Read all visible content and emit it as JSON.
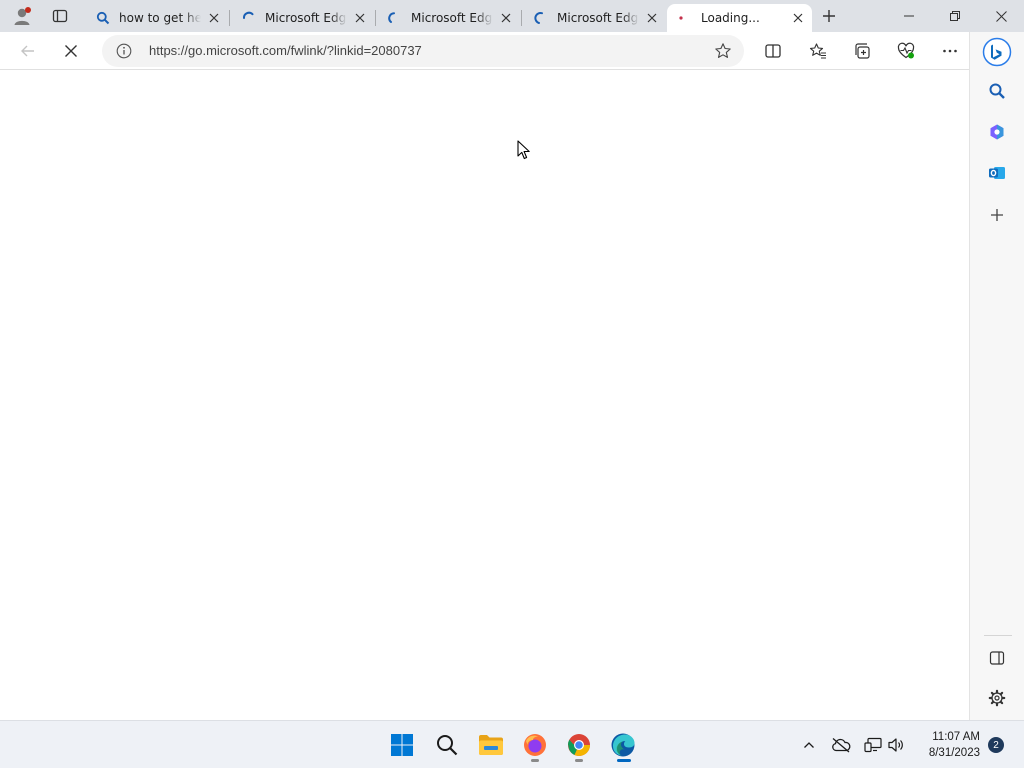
{
  "tabs": [
    {
      "title": "how to get help in windows",
      "icon": "search-icon"
    },
    {
      "title": "Microsoft Edge",
      "icon": "loading-spinner-icon"
    },
    {
      "title": "Microsoft Edge",
      "icon": "loading-spinner-icon"
    },
    {
      "title": "Microsoft Edge",
      "icon": "loading-spinner-icon"
    },
    {
      "title": "Loading...",
      "icon": "loading-dot-icon",
      "active": true
    }
  ],
  "address_bar": {
    "url": "https://go.microsoft.com/fwlink/?linkid=2080737"
  },
  "taskbar": {
    "apps": [
      "windows-start",
      "search",
      "file-explorer",
      "firefox",
      "chrome",
      "edge"
    ],
    "time": "11:07 AM",
    "date": "8/31/2023",
    "notification_count": "2"
  },
  "colors": {
    "tabstrip": "#dee1e6",
    "accent": "#0067c0",
    "taskbar": "#eef1f6"
  }
}
